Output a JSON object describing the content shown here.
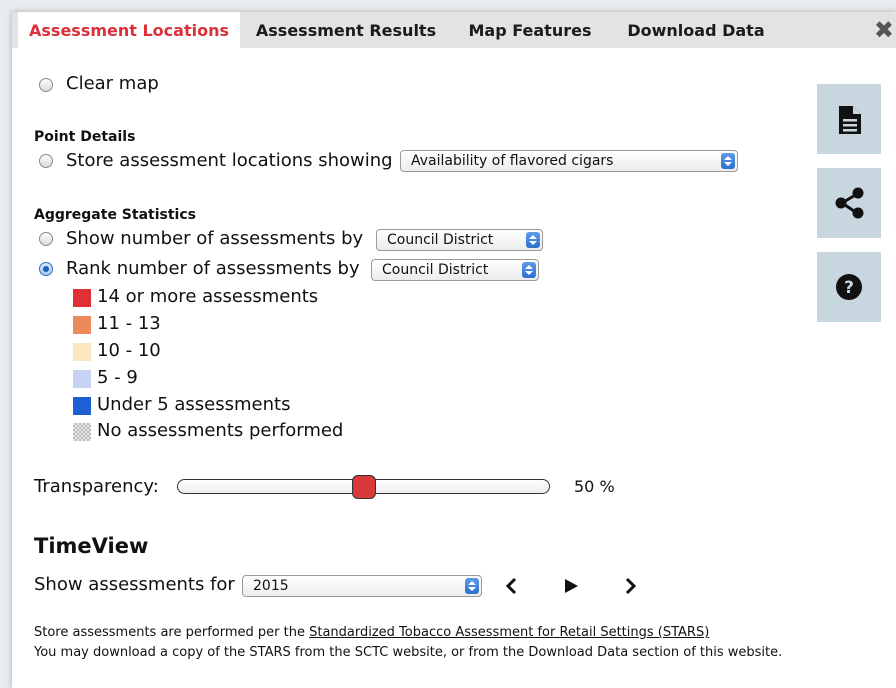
{
  "tabs": [
    {
      "label": "Assessment Locations",
      "active": true
    },
    {
      "label": "Assessment Results",
      "active": false
    },
    {
      "label": "Map Features",
      "active": false
    },
    {
      "label": "Download Data",
      "active": false
    }
  ],
  "close_icon": "close-icon",
  "clear_map": {
    "label": "Clear map",
    "checked": false
  },
  "point_details": {
    "heading": "Point Details",
    "option_label": "Store assessment locations showing",
    "select_value": "Availability of flavored cigars",
    "checked": false
  },
  "aggregate": {
    "heading": "Aggregate Statistics",
    "show": {
      "label": "Show number of assessments by",
      "select_value": "Council District",
      "checked": false
    },
    "rank": {
      "label": "Rank number of assessments by",
      "select_value": "Council District",
      "checked": true
    }
  },
  "legend": [
    {
      "label": "14 or more assessments",
      "color": "#e03034"
    },
    {
      "label": "11 - 13",
      "color": "#ec8a5e"
    },
    {
      "label": "10 - 10",
      "color": "#fbe8c3"
    },
    {
      "label": "5 - 9",
      "color": "#c6d3f4"
    },
    {
      "label": "Under 5 assessments",
      "color": "#1f5fd6"
    },
    {
      "label": "No assessments performed",
      "color": "pattern"
    }
  ],
  "transparency": {
    "label": "Transparency:",
    "value": 0.5,
    "display": "50 %"
  },
  "timeview": {
    "heading": "TimeView",
    "label": "Show assessments for",
    "select_value": "2015",
    "controls": [
      "previous-icon",
      "play-icon",
      "next-icon"
    ]
  },
  "side_buttons": [
    "document-icon",
    "share-icon",
    "help-icon"
  ],
  "footer": {
    "line1_prefix": "Store assessments are performed per the ",
    "line1_link": "Standardized Tobacco Assessment for Retail Settings (STARS)",
    "line2": "You may download a copy of the STARS from the SCTC website, or from the Download Data section of this website."
  }
}
